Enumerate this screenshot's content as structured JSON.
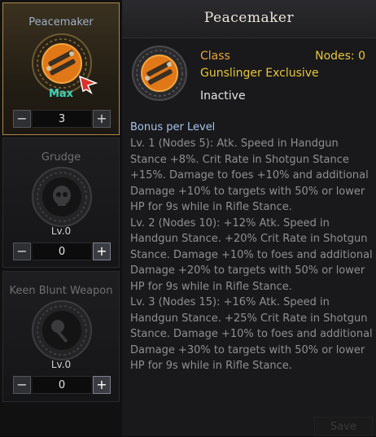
{
  "skill_cards": [
    {
      "name": "Peacemaker",
      "level_text": "Max",
      "level_value": "3",
      "minus": "−",
      "plus": "+",
      "active": true,
      "icon": "twin-pistols-icon"
    },
    {
      "name": "Grudge",
      "level_text": "Lv.0",
      "level_value": "0",
      "minus": "−",
      "plus": "+",
      "active": false,
      "icon": "skull-icon"
    },
    {
      "name": "Keen Blunt Weapon",
      "level_text": "Lv.0",
      "level_value": "0",
      "minus": "−",
      "plus": "+",
      "active": false,
      "icon": "mace-icon"
    }
  ],
  "detail": {
    "title": "Peacemaker",
    "class_label": "Class",
    "nodes_label": "Nodes: 0",
    "exclusive": "Gunslinger Exclusive",
    "status": "Inactive",
    "bonus_header": "Bonus per Level",
    "bonuses": [
      "Lv. 1 (Nodes 5): Atk. Speed in Handgun Stance +8%. Crit Rate in Shotgun Stance +15%. Damage to foes +10% and additional Damage +10% to targets with 50% or lower HP for 9s while in Rifle Stance.",
      "Lv. 2 (Nodes 10): +12% Atk. Speed in Handgun Stance. +20% Crit Rate in Shotgun Stance. Damage +10% to foes and additional Damage +20% to targets with 50% or lower HP for 9s while in Rifle Stance.",
      "Lv. 3 (Nodes 15): +16% Atk. Speed in Handgun Stance. +25% Crit Rate in Shotgun Stance. Damage +10% to foes and additional Damage +30% to targets with 50% or lower HP for 9s while in Rifle Stance."
    ],
    "save_label": "Save"
  },
  "colors": {
    "gold": "#e8c53b",
    "orange": "#e8a33b",
    "teal": "#3fd0b5",
    "blue": "#a8c4ec"
  }
}
